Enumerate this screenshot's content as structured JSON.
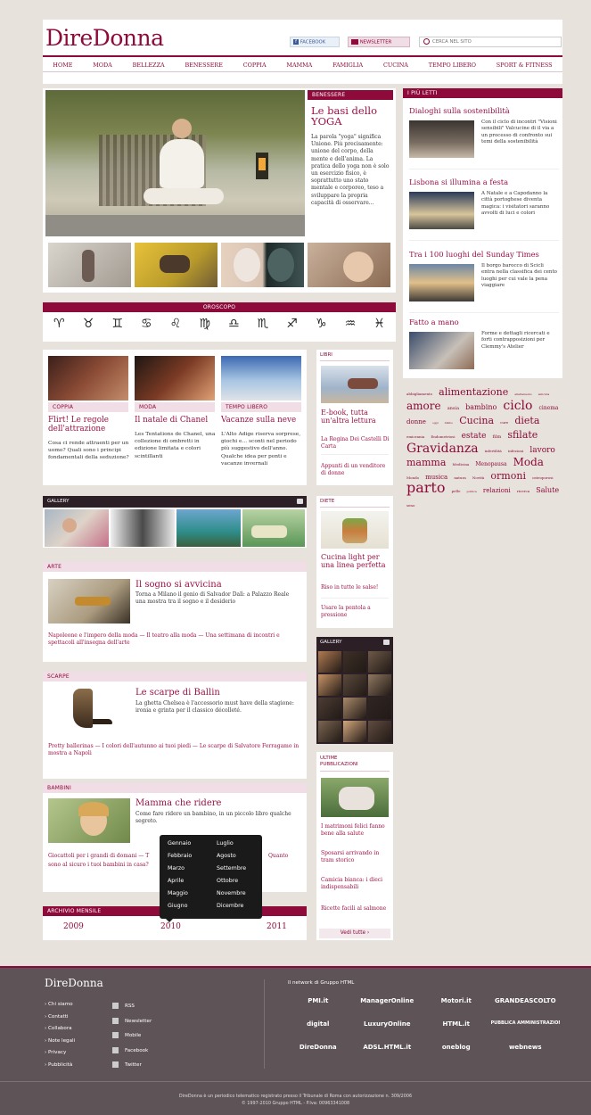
{
  "logo": "DireDonna",
  "topbar": {
    "facebook": "FACEBOOK",
    "newsletter": "NEWSLETTER",
    "search_placeholder": "CERCA NEL SITO"
  },
  "nav": [
    "HOME",
    "MODA",
    "BELLEZZA",
    "BENESSERE",
    "COPPIA",
    "MAMMA",
    "FAMIGLIA",
    "CUCINA",
    "TEMPO LIBERO",
    "SPORT & FITNESS"
  ],
  "hero": {
    "category": "BENESSERE",
    "title": "Le basi dello YOGA",
    "text": "La parola \"yoga\" significa Unione. Più precisamente: unione del corpo, della mente e dell'anima. La pratica dello yoga non è solo un esercizio fisico, è soprattutto uno stato mentale e corporeo, teso a sviluppare la propria capacità di osservare..."
  },
  "most_read": {
    "title": "I PIÙ LETTI",
    "items": [
      {
        "title": "Dialoghi sulla sostenibilità",
        "text": "Con il ciclo di incontri \"Visioni sensibili\" Valcucine di il via a un processo di confronto sui temi della sostenibilità"
      },
      {
        "title": "Lisbona si illumina a festa",
        "text": "A Natale e a Capodanno la città portoghese diventa magica: i visitatori saranno avvolti di luci e colori"
      },
      {
        "title": "Tra i 100 luoghi del Sunday Times",
        "text": "Il borgo barocco di Scicli entra nella classifica dei cento luoghi per cui vale la pena viaggiare"
      },
      {
        "title": "Fatto a mano",
        "text": "Forme e dettagli ricercati e forti contrapposizioni per Clemmy's Atelier"
      }
    ]
  },
  "horoscope": {
    "title": "OROSCOPO",
    "signs": [
      "♈",
      "♉",
      "♊",
      "♋",
      "♌",
      "♍",
      "♎",
      "♏",
      "♐",
      "♑",
      "♒",
      "♓"
    ]
  },
  "features": [
    {
      "category": "COPPIA",
      "title": "Flirt! Le regole dell'attrazione",
      "text": "Cosa ci rende attraenti per un uomo? Quali sono i principi fondamentali della seduzione?"
    },
    {
      "category": "MODA",
      "title": "Il natale di Chanel",
      "text": "Les Tentations de Chanel, una collezione di ombretti in edizione limitata e colori scintillanti"
    },
    {
      "category": "TEMPO LIBERO",
      "title": "Vacanze sulla neve",
      "text": "L'Alto Adige riserva sorprese, giochi e... sconti nel periodo più suggestivo dell'anno. Qualche idea per ponti e vacanze invernali"
    }
  ],
  "libri": {
    "title": "LIBRI",
    "headline": "E-book, tutta un'altra lettura",
    "links": [
      "La Regina Dei Castelli Di Carta",
      "Appunti di un venditore di donne"
    ]
  },
  "gallery": {
    "title": "GALLERY"
  },
  "diete": {
    "title": "DIETE",
    "headline": "Cucina light per una linea perfetta",
    "links": [
      "Riso in tutte le salse!",
      "Usare la pentola a pressione"
    ]
  },
  "arte": {
    "title": "ARTE",
    "headline": "Il sogno si avvicina",
    "text": "Torna a Milano il genio di Salvador Dalì: a Palazzo Reale una mostra tra il sogno e il desiderio",
    "links": "Napoleone e l'impero della moda — Il teatro alla moda — Una settimana di incontri e spettacoli all'insegna dell'arte"
  },
  "scarpe": {
    "title": "SCARPE",
    "headline": "Le scarpe di Ballin",
    "text": "La ghetta Chelsea è l'accessorio must have della stagione: ironia e grinta per il classico décolleté.",
    "links": "Pretty ballerinas — I colori dell'autunno ai tuoi piedi — Le scarpe di Salvatore Ferragamo in mostra a Napoli"
  },
  "bambini": {
    "title": "BAMBINI",
    "headline": "Mamma che ridere",
    "text": "Come fare ridere un bambino, in un piccolo libro qualche segreto.",
    "links_left": "Giocattoli per i grandi di domani — T",
    "links_right": "Quanto",
    "links_line2": "sono al sicuro i tuoi bambini in casa?"
  },
  "gallery2": {
    "title": "GALLERY"
  },
  "ultime": {
    "title": "ULTIME PUBBLICAZIONI",
    "links": [
      "I matrimoni felici fanno bene alla salute",
      "Sposarsi arrivando in tram storico",
      "Camicia bianca: i dieci indispensabili",
      "Ricette facili al salmone"
    ],
    "more": "Vedi tutte  ›"
  },
  "archivio": {
    "title": "ARCHIVIO MENSILE",
    "years": [
      "2009",
      "2010",
      "2011"
    ],
    "months_left": [
      "Gennaio",
      "Febbraio",
      "Marzo",
      "Aprile",
      "Maggio",
      "Giugno"
    ],
    "months_right": [
      "Luglio",
      "Agosto",
      "Settembre",
      "Ottobre",
      "Novembre",
      "Dicembre"
    ]
  },
  "tags": [
    [
      "abbigliamento",
      4
    ],
    [
      "alimentazione",
      11
    ],
    [
      "allattamento",
      3
    ],
    [
      "amicizia",
      3
    ],
    [
      "amore",
      12
    ],
    [
      "ansia",
      5
    ],
    [
      "bambino",
      8
    ],
    [
      "ciclo",
      14
    ],
    [
      "cinema",
      6
    ],
    [
      "donne",
      7
    ],
    [
      "oggi",
      3
    ],
    [
      "bimbo",
      3
    ],
    [
      "Cucina",
      11
    ],
    [
      "cure",
      4
    ],
    [
      "dieta",
      11
    ],
    [
      "emicrania",
      4
    ],
    [
      "Endometriosi",
      4
    ],
    [
      "estate",
      9
    ],
    [
      "film",
      5
    ],
    [
      "sfilate",
      11
    ],
    [
      "Gravidanza",
      14
    ],
    [
      "infertilità",
      4
    ],
    [
      "infezioni",
      4
    ],
    [
      "lavoro",
      9
    ],
    [
      "mamma",
      11
    ],
    [
      "Medicina",
      4
    ],
    [
      "Menopausa",
      6
    ],
    [
      "Moda",
      12
    ],
    [
      "Mondo",
      4
    ],
    [
      "musica",
      7
    ],
    [
      "natura",
      4
    ],
    [
      "Novità",
      4
    ],
    [
      "ormoni",
      11
    ],
    [
      "osteoporosi",
      4
    ],
    [
      "parto",
      16
    ],
    [
      "pelle",
      4
    ],
    [
      "politica",
      3
    ],
    [
      "relazioni",
      7
    ],
    [
      "ricerca",
      4
    ],
    [
      "Salute",
      8
    ],
    [
      "seno",
      4
    ]
  ],
  "footer": {
    "logo": "DireDonna",
    "links": [
      "Chi siamo",
      "Contatti",
      "Collabora",
      "Note legali",
      "Privacy",
      "Pubblicità"
    ],
    "social": [
      "RSS",
      "Newsletter",
      "Mobile",
      "Facebook",
      "Twitter"
    ],
    "network_title": "Il network di Gruppo HTML",
    "network": [
      "PMI.it",
      "ManagerOnline",
      "Motori.it",
      "GRANDEASCOLTO",
      "digital",
      "LuxuryOnline",
      "HTML.it",
      "PUBBLICA AMMINISTRAZIONE",
      "DireDonna",
      "ADSL.HTML.it",
      "oneblog",
      "webnews"
    ],
    "legal1": "DireDonna è un periodico telematico registrato presso il Tribunale di Roma con autorizzazione n. 309/2006",
    "legal2": "© 1997-2010 Gruppo HTML  -  P.Iva: 00963341008"
  },
  "colors": {
    "accent": "#8d0a3a",
    "page_bg": "#e7e3dc",
    "footer_bg": "#5e5458"
  }
}
